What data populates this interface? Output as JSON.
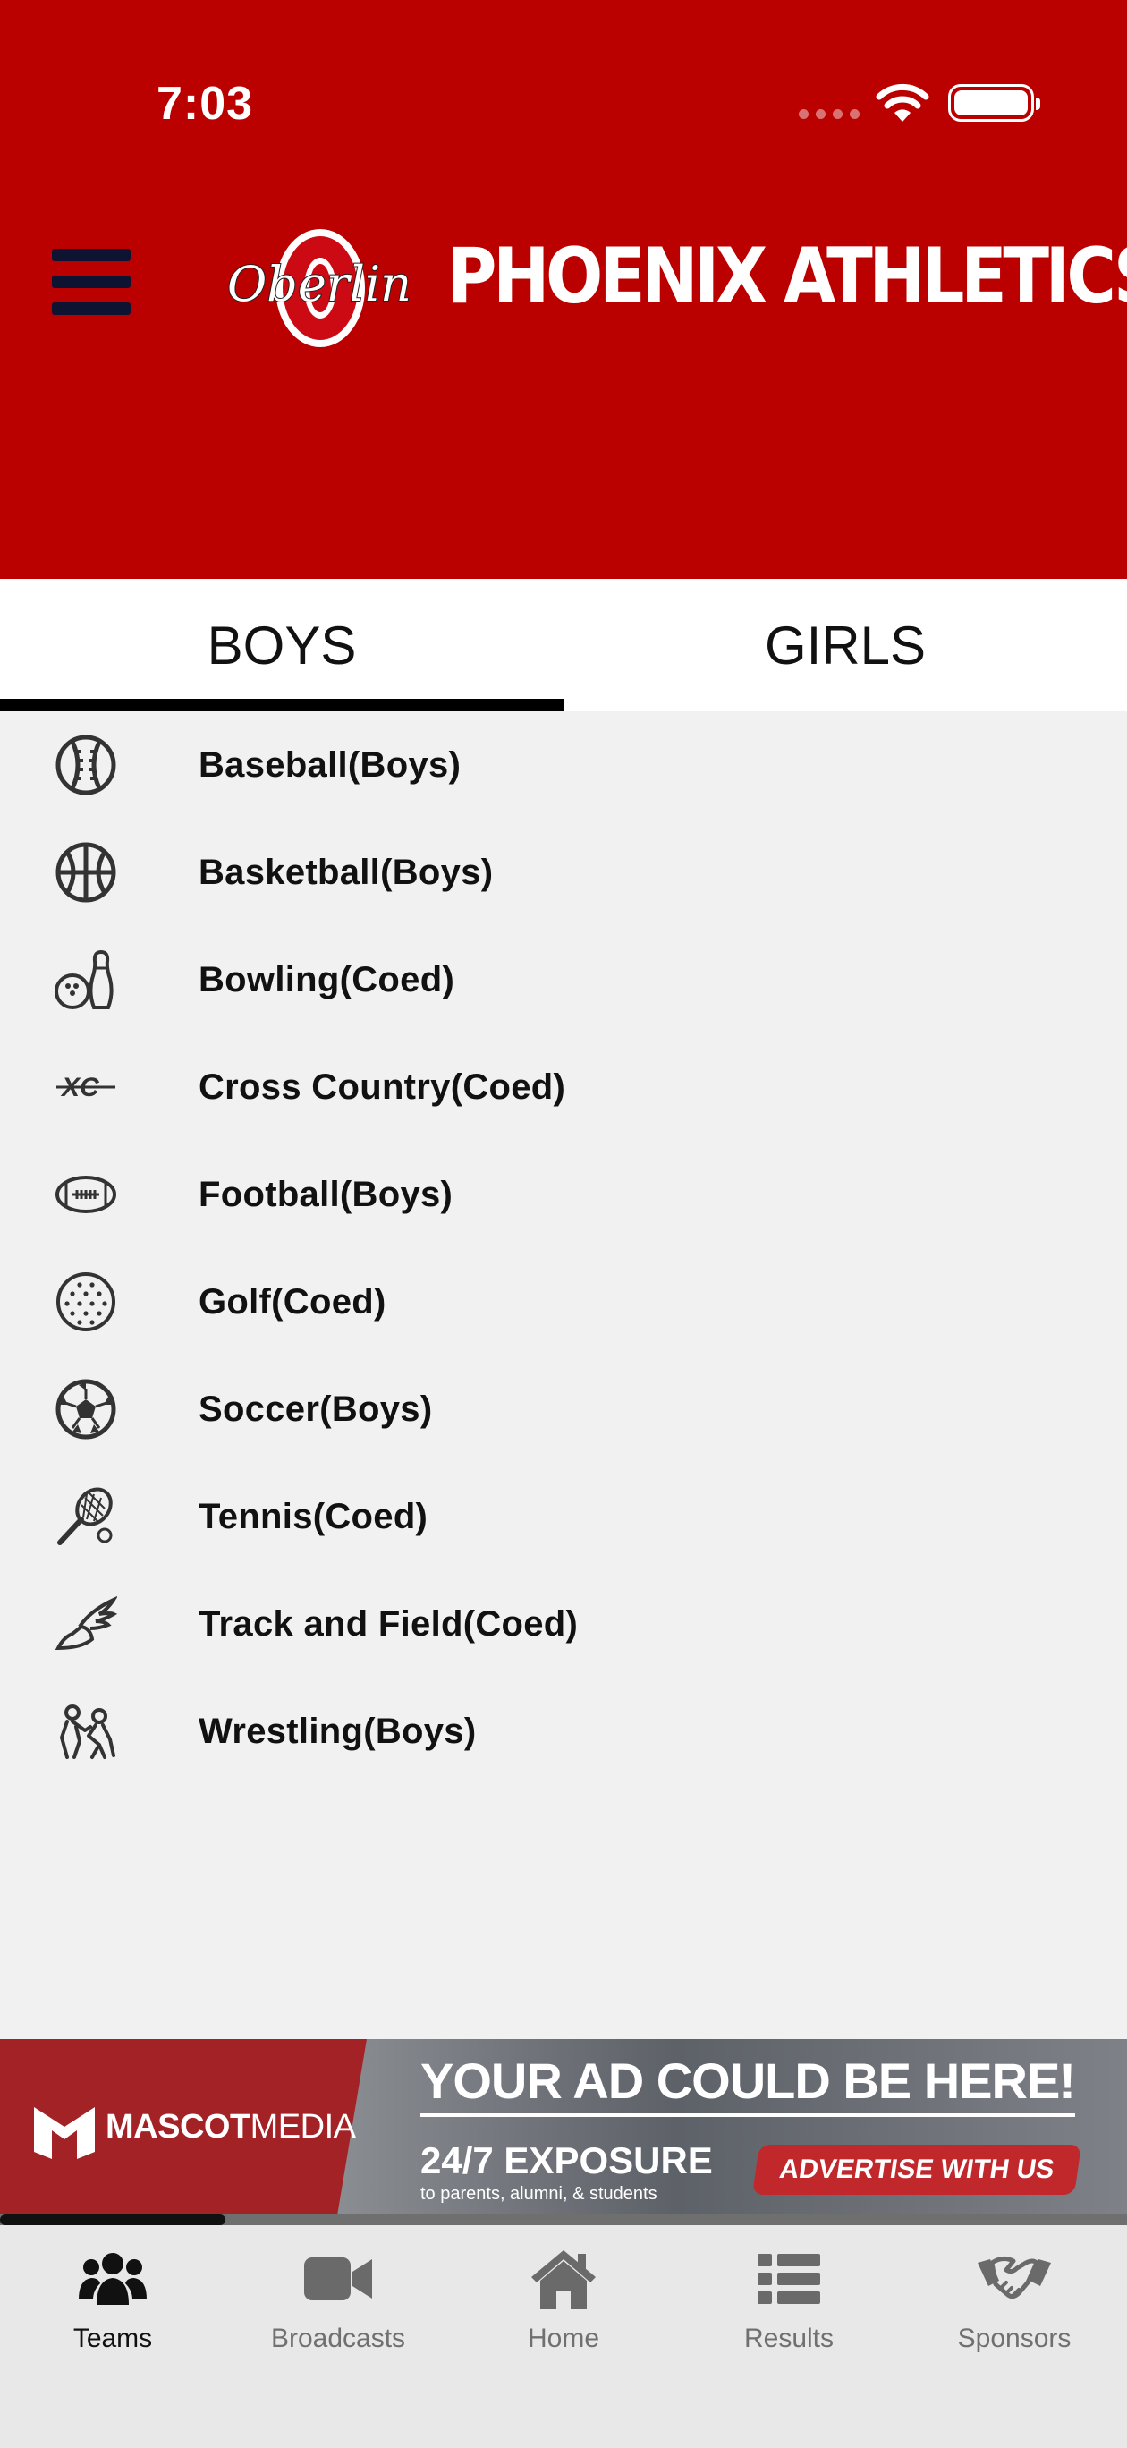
{
  "status_bar": {
    "time": "7:03"
  },
  "header": {
    "logo_text": "Oberlin",
    "title": "PHOENIX ATHLETICS",
    "colors": {
      "primary": "#bb0000",
      "menu": "#0d1330"
    }
  },
  "tabs": [
    {
      "label": "BOYS",
      "active": true
    },
    {
      "label": "GIRLS",
      "active": false
    }
  ],
  "sports": [
    {
      "label": "Baseball(Boys)",
      "icon": "baseball-icon"
    },
    {
      "label": "Basketball(Boys)",
      "icon": "basketball-icon"
    },
    {
      "label": "Bowling(Coed)",
      "icon": "bowling-icon"
    },
    {
      "label": "Cross Country(Coed)",
      "icon": "cross-country-icon"
    },
    {
      "label": "Football(Boys)",
      "icon": "football-icon"
    },
    {
      "label": "Golf(Coed)",
      "icon": "golf-ball-icon"
    },
    {
      "label": "Soccer(Boys)",
      "icon": "soccer-ball-icon"
    },
    {
      "label": "Tennis(Coed)",
      "icon": "tennis-icon"
    },
    {
      "label": "Track and Field(Coed)",
      "icon": "winged-shoe-icon"
    },
    {
      "label": "Wrestling(Boys)",
      "icon": "wrestling-icon"
    }
  ],
  "ad": {
    "brand_bold": "MASCOT",
    "brand_light": "MEDIA",
    "headline": "YOUR AD COULD BE HERE!",
    "exposure": "24/7 EXPOSURE",
    "sub": "to parents, alumni, & students",
    "cta": "ADVERTISE WITH US",
    "carousel_progress": 0.2
  },
  "nav": {
    "items": [
      {
        "label": "Teams",
        "icon": "teams-icon",
        "active": true
      },
      {
        "label": "Broadcasts",
        "icon": "video-camera-icon",
        "active": false
      },
      {
        "label": "Home",
        "icon": "home-icon",
        "active": false
      },
      {
        "label": "Results",
        "icon": "list-icon",
        "active": false
      },
      {
        "label": "Sponsors",
        "icon": "handshake-icon",
        "active": false
      }
    ]
  }
}
